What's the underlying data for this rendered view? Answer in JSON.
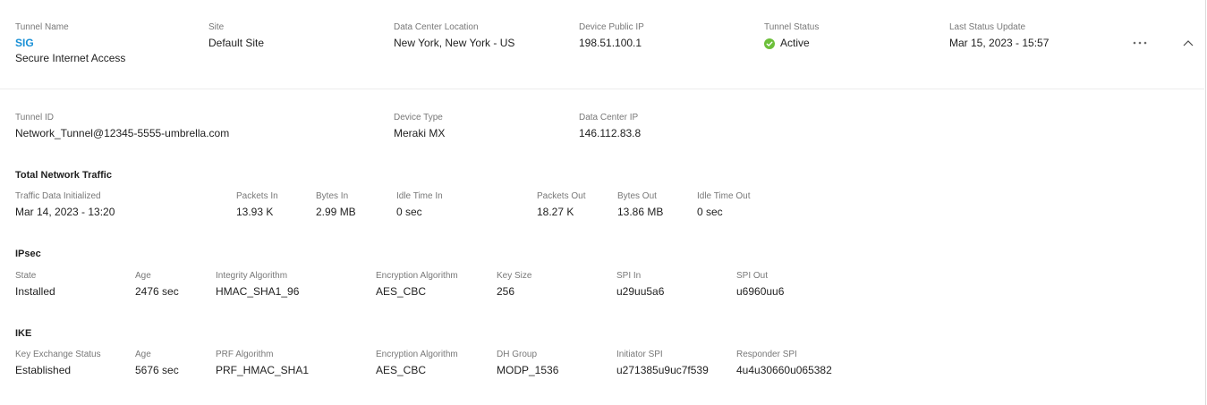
{
  "header": {
    "tunnel_name": {
      "label": "Tunnel Name",
      "value": "SIG",
      "subtitle": "Secure Internet Access"
    },
    "site": {
      "label": "Site",
      "value": "Default Site"
    },
    "dc_location": {
      "label": "Data Center Location",
      "value": "New York, New York - US"
    },
    "public_ip": {
      "label": "Device Public IP",
      "value": "198.51.100.1"
    },
    "status": {
      "label": "Tunnel Status",
      "value": "Active",
      "color": "#6cbf3a"
    },
    "last_update": {
      "label": "Last Status Update",
      "value": "Mar 15, 2023 - 15:57"
    },
    "more_icon": "ellipsis-icon",
    "collapse_icon": "chevron-up-icon"
  },
  "details": {
    "tunnel_id": {
      "label": "Tunnel ID",
      "value": "Network_Tunnel@12345-5555-umbrella.com"
    },
    "device_type": {
      "label": "Device Type",
      "value": "Meraki MX"
    },
    "dc_ip": {
      "label": "Data Center IP",
      "value": "146.112.83.8"
    }
  },
  "traffic": {
    "title": "Total Network Traffic",
    "initialized": {
      "label": "Traffic Data Initialized",
      "value": "Mar 14, 2023 - 13:20"
    },
    "packets_in": {
      "label": "Packets In",
      "value": "13.93 K"
    },
    "bytes_in": {
      "label": "Bytes In",
      "value": "2.99 MB"
    },
    "idle_in": {
      "label": "Idle Time In",
      "value": "0 sec"
    },
    "packets_out": {
      "label": "Packets Out",
      "value": "18.27 K"
    },
    "bytes_out": {
      "label": "Bytes Out",
      "value": "13.86 MB"
    },
    "idle_out": {
      "label": "Idle Time Out",
      "value": "0 sec"
    }
  },
  "ipsec": {
    "title": "IPsec",
    "state": {
      "label": "State",
      "value": "Installed"
    },
    "age": {
      "label": "Age",
      "value": "2476 sec"
    },
    "integrity": {
      "label": "Integrity Algorithm",
      "value": "HMAC_SHA1_96"
    },
    "encryption": {
      "label": "Encryption Algorithm",
      "value": "AES_CBC"
    },
    "key_size": {
      "label": "Key Size",
      "value": "256"
    },
    "spi_in": {
      "label": "SPI In",
      "value": "u29uu5a6"
    },
    "spi_out": {
      "label": "SPI Out",
      "value": "u6960uu6"
    }
  },
  "ike": {
    "title": "IKE",
    "key_exchange": {
      "label": "Key Exchange Status",
      "value": "Established"
    },
    "age": {
      "label": "Age",
      "value": "5676 sec"
    },
    "prf": {
      "label": "PRF Algorithm",
      "value": "PRF_HMAC_SHA1"
    },
    "encryption": {
      "label": "Encryption Algorithm",
      "value": "AES_CBC"
    },
    "dh_group": {
      "label": "DH Group",
      "value": "MODP_1536"
    },
    "initiator_spi": {
      "label": "Initiator SPI",
      "value": "u271385u9uc7f539"
    },
    "responder_spi": {
      "label": "Responder SPI",
      "value": "4u4u30660u065382"
    }
  }
}
